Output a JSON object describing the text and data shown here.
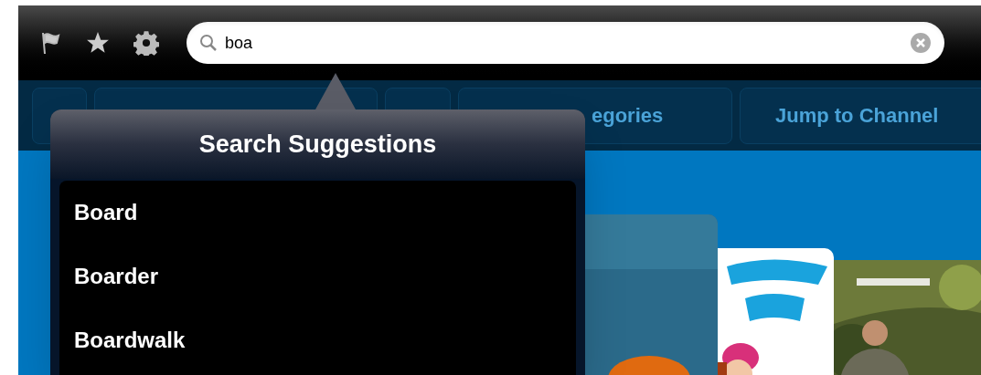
{
  "toolbar": {
    "search": {
      "value": "boa"
    }
  },
  "nav_buttons": [
    {
      "label": "egories"
    },
    {
      "label": "Jump to Channel"
    }
  ],
  "popover": {
    "title": "Search Suggestions",
    "suggestions": [
      "Board",
      "Boarder",
      "Boardwalk"
    ]
  }
}
